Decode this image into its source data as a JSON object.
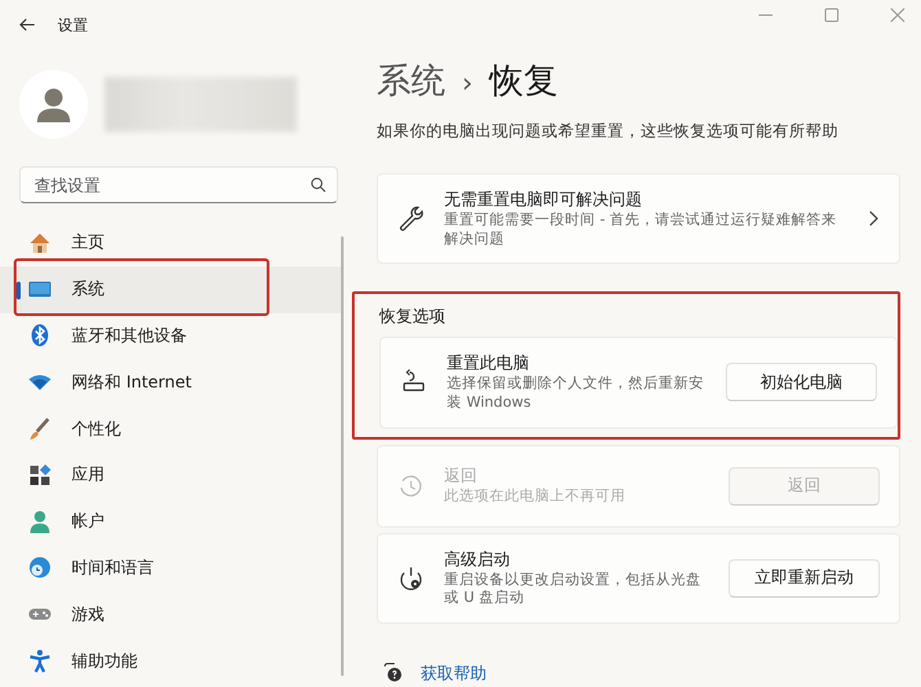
{
  "window": {
    "title": "设置"
  },
  "search": {
    "placeholder": "查找设置"
  },
  "nav": [
    {
      "kind": "home",
      "label": "主页",
      "selected": false,
      "highlighted": false
    },
    {
      "kind": "system",
      "label": "系统",
      "selected": true,
      "highlighted": true
    },
    {
      "kind": "bluetooth",
      "label": "蓝牙和其他设备",
      "selected": false,
      "highlighted": false
    },
    {
      "kind": "network",
      "label": "网络和 Internet",
      "selected": false,
      "highlighted": false
    },
    {
      "kind": "personalization",
      "label": "个性化",
      "selected": false,
      "highlighted": false
    },
    {
      "kind": "apps",
      "label": "应用",
      "selected": false,
      "highlighted": false
    },
    {
      "kind": "accounts",
      "label": "帐户",
      "selected": false,
      "highlighted": false
    },
    {
      "kind": "time",
      "label": "时间和语言",
      "selected": false,
      "highlighted": false
    },
    {
      "kind": "gaming",
      "label": "游戏",
      "selected": false,
      "highlighted": false
    },
    {
      "kind": "accessibility",
      "label": "辅助功能",
      "selected": false,
      "highlighted": false
    }
  ],
  "breadcrumb": {
    "parent": "系统",
    "separator": "›",
    "current": "恢复"
  },
  "description": "如果你的电脑出现问题或希望重置，这些恢复选项可能有所帮助",
  "troubleshoot_card": {
    "title": "无需重置电脑即可解决问题",
    "description": "重置可能需要一段时间 - 首先，请尝试通过运行疑难解答来解决问题"
  },
  "recovery_options": {
    "title": "恢复选项",
    "highlighted": true,
    "items": [
      {
        "kind": "reset",
        "title": "重置此电脑",
        "description": "选择保留或删除个人文件，然后重新安装 Windows",
        "button": "初始化电脑",
        "disabled": false
      },
      {
        "kind": "goback",
        "title": "返回",
        "description": "此选项在此电脑上不再可用",
        "button": "返回",
        "disabled": true
      },
      {
        "kind": "advanced",
        "title": "高级启动",
        "description": "重启设备以更改启动设置，包括从光盘或 U 盘启动",
        "button": "立即重新启动",
        "disabled": false
      }
    ]
  },
  "help_link": "获取帮助"
}
